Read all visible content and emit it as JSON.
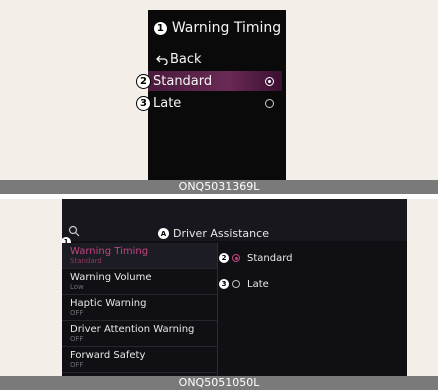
{
  "top": {
    "callout_1": "1",
    "title": "Warning Timing",
    "back_icon": "back-arrow-icon",
    "back_label": "Back",
    "options": [
      {
        "callout": "2",
        "label": "Standard",
        "selected": true
      },
      {
        "callout": "3",
        "label": "Late",
        "selected": false
      }
    ],
    "code": "ONQ5031369L"
  },
  "bottom": {
    "search_icon": "search-icon",
    "header_badge": "A",
    "header_title": "Driver Assistance",
    "menu_callout": "1",
    "menu": [
      {
        "title": "Warning Timing",
        "subtitle": "Standard",
        "active": true
      },
      {
        "title": "Warning Volume",
        "subtitle": "Low",
        "active": false
      },
      {
        "title": "Haptic Warning",
        "subtitle": "OFF",
        "active": false
      },
      {
        "title": "Driver Attention Warning",
        "subtitle": "OFF",
        "active": false
      },
      {
        "title": "Forward Safety",
        "subtitle": "OFF",
        "active": false
      }
    ],
    "options": [
      {
        "callout": "2",
        "label": "Standard",
        "selected": true
      },
      {
        "callout": "3",
        "label": "Late",
        "selected": false
      }
    ],
    "code": "ONQ5051050L"
  },
  "colors": {
    "accent": "#c2447e",
    "cluster_highlight": "#6a2a55",
    "caption_bar": "#7a7a7a",
    "background": "#f3eee8"
  }
}
